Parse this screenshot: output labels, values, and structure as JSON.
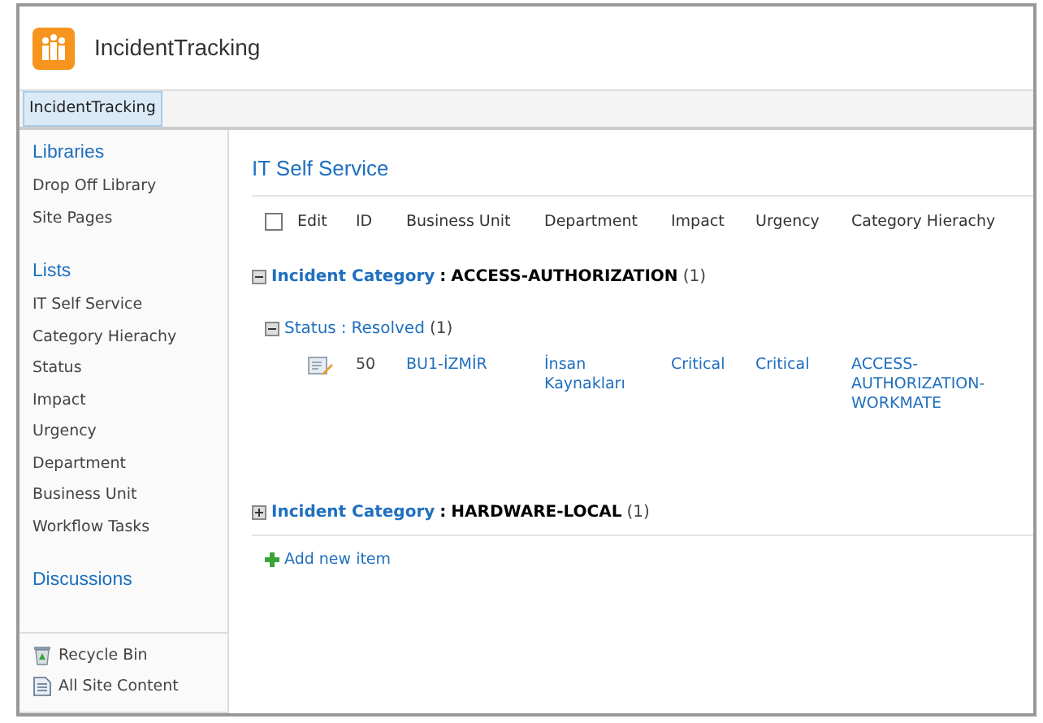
{
  "site": {
    "title": "IncidentTracking"
  },
  "topnav": [
    {
      "label": "IncidentTracking",
      "selected": true
    }
  ],
  "sidebar": {
    "sections": [
      {
        "heading": "Libraries",
        "items": [
          "Drop Off Library",
          "Site Pages"
        ]
      },
      {
        "heading": "Lists",
        "items": [
          "IT Self Service",
          "Category Hierachy",
          "Status",
          "Impact",
          "Urgency",
          "Department",
          "Business Unit",
          "Workflow Tasks"
        ]
      },
      {
        "heading": "Discussions"
      }
    ],
    "footer": [
      {
        "kind": "recycle",
        "label": "Recycle Bin"
      },
      {
        "kind": "content",
        "label": "All Site Content"
      }
    ]
  },
  "list": {
    "title": "IT Self Service",
    "select_all_checked": false,
    "columns": [
      "Edit",
      "ID",
      "Business Unit",
      "Department",
      "Impact",
      "Urgency",
      "Category Hierachy"
    ],
    "groups": [
      {
        "label": "Incident Category",
        "separator": ":",
        "value": "ACCESS-AUTHORIZATION",
        "count": "(1)",
        "expanded": true,
        "subgroups": [
          {
            "label": "Status",
            "separator": ":",
            "value": "Resolved",
            "count": "(1)",
            "expanded": true,
            "rows": [
              {
                "id": "50",
                "business_unit": "BU1-İZMİR",
                "department": "İnsan Kaynakları",
                "impact": "Critical",
                "urgency": "Critical",
                "category": "ACCESS-AUTHORIZATION-WORKMATE"
              }
            ]
          }
        ]
      },
      {
        "label": "Incident Category",
        "separator": ":",
        "value": "HARDWARE-LOCAL",
        "count": "(1)",
        "expanded": false
      }
    ],
    "add_item": "Add new item"
  }
}
